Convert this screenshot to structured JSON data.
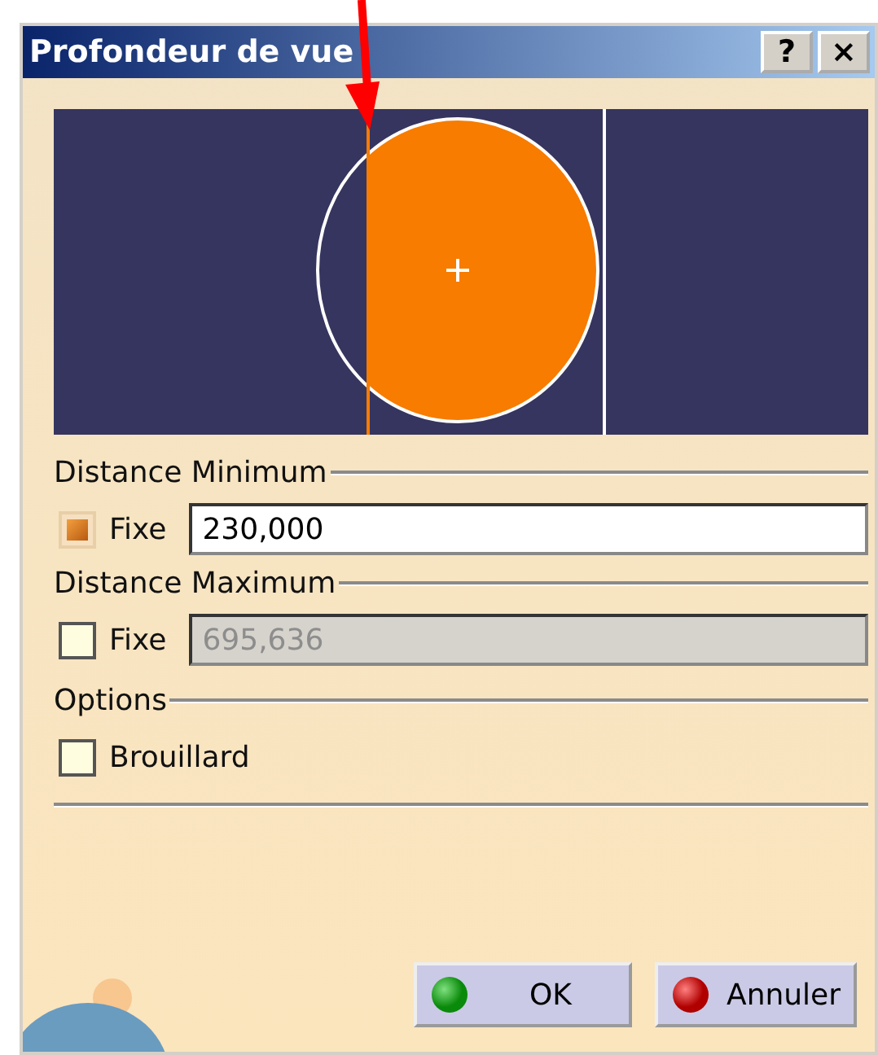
{
  "window": {
    "title": "Profondeur de vue",
    "help": "?",
    "close": "×"
  },
  "sections": [
    {
      "title": "Distance Minimum",
      "checkbox": {
        "label": "Fixe",
        "checked": true
      },
      "field": {
        "value": "230,000",
        "disabled": false
      }
    },
    {
      "title": "Distance Maximum",
      "checkbox": {
        "label": "Fixe",
        "checked": false
      },
      "field": {
        "value": "695,636",
        "disabled": true
      }
    }
  ],
  "options": {
    "title": "Options",
    "items": [
      {
        "label": "Brouillard",
        "checked": false
      }
    ]
  },
  "buttons": [
    {
      "label": "OK",
      "kind": "ok"
    },
    {
      "label": "Annuler",
      "kind": "cancel"
    }
  ]
}
